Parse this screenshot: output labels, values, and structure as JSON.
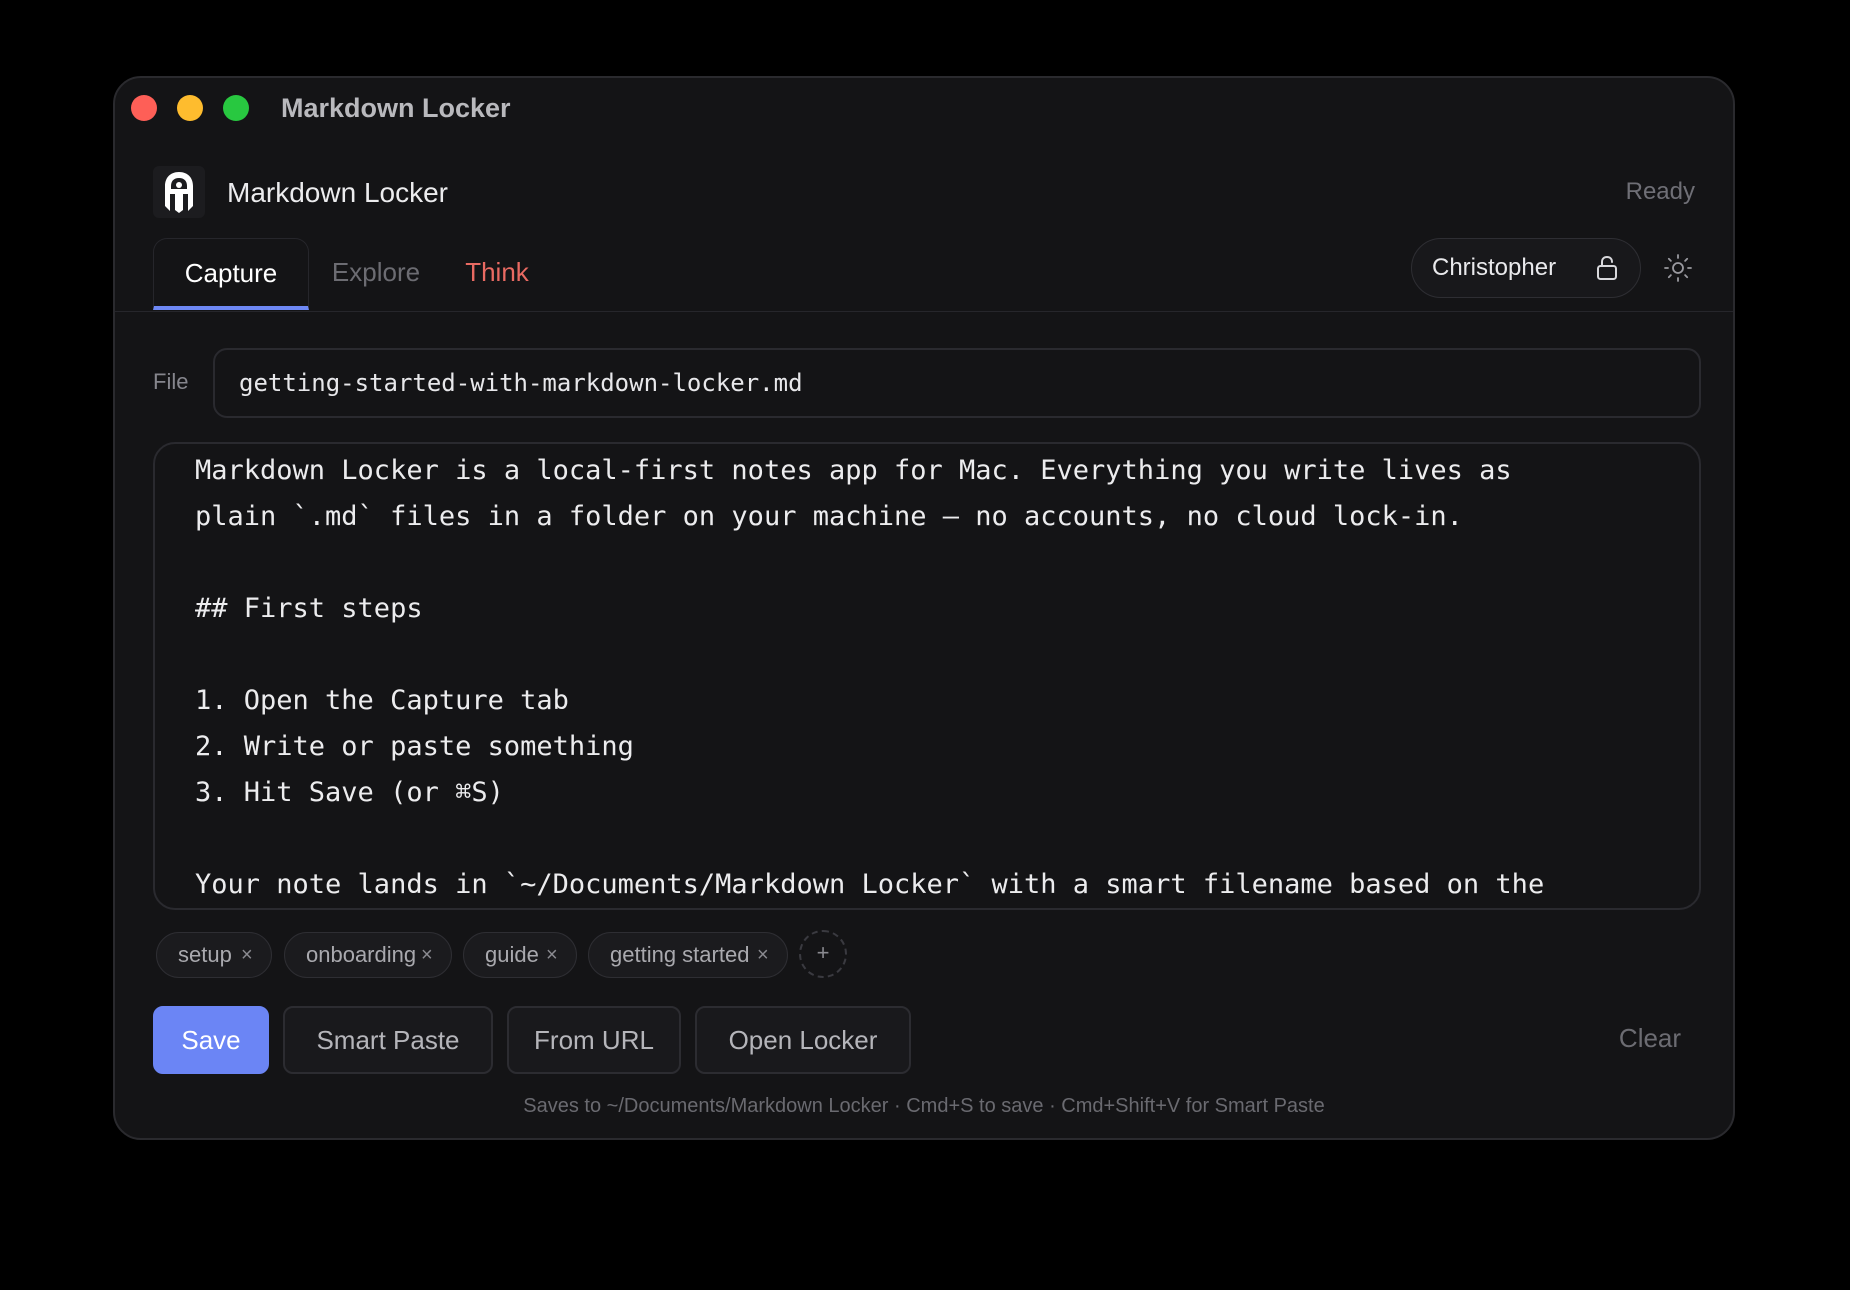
{
  "window": {
    "title": "Markdown Locker"
  },
  "app": {
    "name": "Markdown Locker",
    "status": "Ready",
    "logo_icon": "locker-logo-icon"
  },
  "tabs": [
    {
      "label": "Capture",
      "active": true
    },
    {
      "label": "Explore",
      "active": false
    },
    {
      "label": "Think",
      "active": false
    }
  ],
  "user": {
    "name": "Christopher",
    "icon": "lock-icon"
  },
  "theme_icon": "sun-icon",
  "file": {
    "label": "File",
    "value": "getting-started-with-markdown-locker.md"
  },
  "editor": {
    "content": "Markdown Locker is a local-first notes app for Mac. Everything you write lives as\nplain `.md` files in a folder on your machine — no accounts, no cloud lock-in.\n\n## First steps\n\n1. Open the Capture tab\n2. Write or paste something\n3. Hit Save (or ⌘S)\n\nYour note lands in `~/Documents/Markdown Locker` with a smart filename based on the"
  },
  "tags": [
    {
      "label": "setup"
    },
    {
      "label": "onboarding"
    },
    {
      "label": "guide"
    },
    {
      "label": "getting started"
    }
  ],
  "tag_remove_glyph": "×",
  "tag_add_glyph": "+",
  "actions": {
    "save": "Save",
    "smart_paste": "Smart Paste",
    "from_url": "From URL",
    "open_locker": "Open Locker",
    "clear": "Clear"
  },
  "footer": {
    "hint": "Saves to ~/Documents/Markdown Locker · Cmd+S to save · Cmd+Shift+V for Smart Paste"
  },
  "colors": {
    "accent": "#6b85f5",
    "think_tab": "#e96a62",
    "background": "#141416"
  }
}
